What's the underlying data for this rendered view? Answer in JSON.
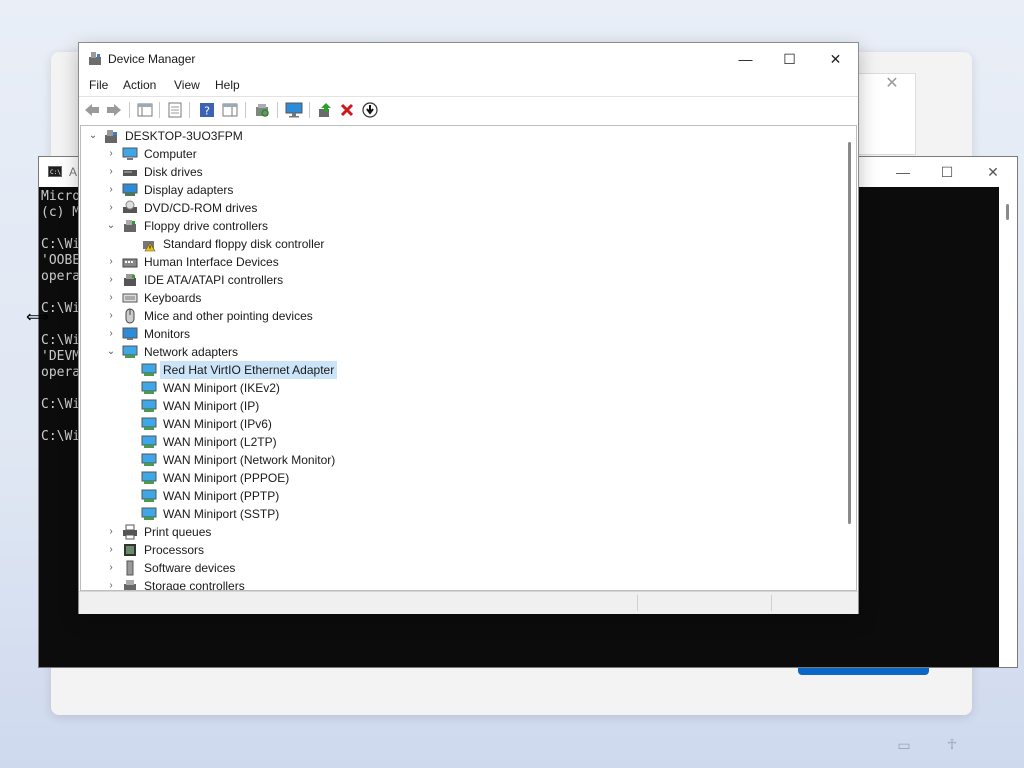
{
  "device_manager": {
    "title": "Device Manager",
    "controls": {
      "minimize": "—",
      "maximize": "☐",
      "close": "✕"
    },
    "menu": [
      "File",
      "Action",
      "View",
      "Help"
    ],
    "toolbar": [
      "back-icon",
      "forward-icon",
      "show-hide-console-tree-icon",
      "properties-icon",
      "help-icon",
      "action-pane-icon",
      "scan-hardware-icon",
      "monitor-icon",
      "update-driver-icon",
      "uninstall-icon",
      "disable-device-icon"
    ],
    "tree": {
      "root": "DESKTOP-3UO3FPM",
      "categories": [
        "Computer",
        "Disk drives",
        "Display adapters",
        "DVD/CD-ROM drives",
        "Floppy drive controllers",
        "Standard floppy disk controller",
        "Human Interface Devices",
        "IDE ATA/ATAPI controllers",
        "Keyboards",
        "Mice and other pointing devices",
        "Monitors",
        "Network adapters",
        "Red Hat VirtIO Ethernet Adapter",
        "WAN Miniport (IKEv2)",
        "WAN Miniport (IP)",
        "WAN Miniport (IPv6)",
        "WAN Miniport (L2TP)",
        "WAN Miniport (Network Monitor)",
        "WAN Miniport (PPPOE)",
        "WAN Miniport (PPTP)",
        "WAN Miniport (SSTP)",
        "Print queues",
        "Processors",
        "Software devices",
        "Storage controllers"
      ],
      "selected": "Red Hat VirtIO Ethernet Adapter"
    }
  },
  "console": {
    "title": "A",
    "controls": {
      "minimize": "—",
      "maximize": "☐",
      "close": "✕"
    },
    "lines": "Micro\n(c) M\n\nC:\\Wi\n'OOBE\nopera\n\nC:\\Wi\n\nC:\\Wi\n'DEVM\nopera\n\nC:\\Wi\n\nC:\\Wi"
  },
  "oobe": {
    "close": "✕"
  },
  "colors": {
    "selection": "#cce4f7",
    "console_bg": "#0c0c0c",
    "accent_blue": "#0a67c6"
  }
}
